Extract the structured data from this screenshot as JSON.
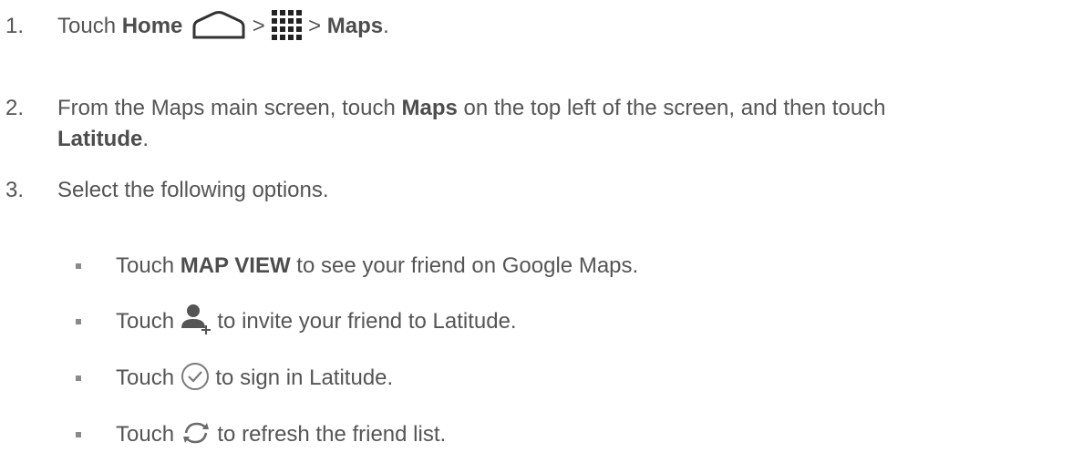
{
  "steps": [
    {
      "num": "1.",
      "parts": {
        "a": "Touch ",
        "home": "Home",
        "sep1": " > ",
        "sep2": " > ",
        "maps": "Maps",
        "end": "."
      },
      "icons": [
        "home-outline-icon",
        "app-grid-icon"
      ]
    },
    {
      "num": "2.",
      "line1_a": "From the Maps main screen, touch ",
      "line1_b": "Maps",
      "line1_c": " on the top left of the screen, and then touch",
      "line2_b": "Latitude",
      "line2_c": "."
    },
    {
      "num": "3.",
      "text": "Select the following options."
    }
  ],
  "options": [
    {
      "a": "Touch ",
      "b": "MAP VIEW",
      "c": " to see your friend on Google Maps."
    },
    {
      "a": "Touch ",
      "icon": "add-person-icon",
      "c": " to invite your friend to Latitude."
    },
    {
      "a": "Touch ",
      "icon": "check-circle-icon",
      "c": " to sign in Latitude."
    },
    {
      "a": "Touch ",
      "icon": "refresh-icon",
      "c": " to refresh the friend list."
    }
  ]
}
